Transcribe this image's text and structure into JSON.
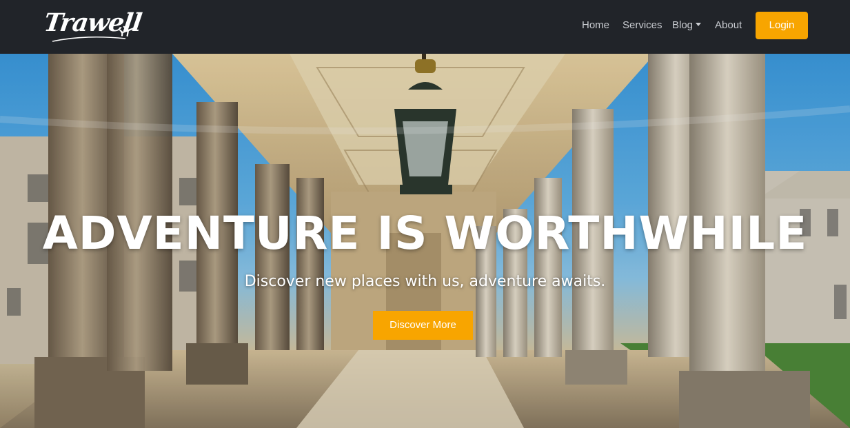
{
  "brand": {
    "name": "Trawell",
    "icon": "airplane-icon"
  },
  "nav": {
    "home": "Home",
    "services": "Services",
    "blog": "Blog",
    "about": "About",
    "login": "Login"
  },
  "hero": {
    "title": "ADVENTURE IS WORTHWHILE",
    "subtitle": "Discover new places with us, adventure awaits.",
    "cta": "Discover More"
  },
  "colors": {
    "navbar_bg": "#212429",
    "accent": "#f8a500",
    "nav_text": "#c9ccd1"
  }
}
